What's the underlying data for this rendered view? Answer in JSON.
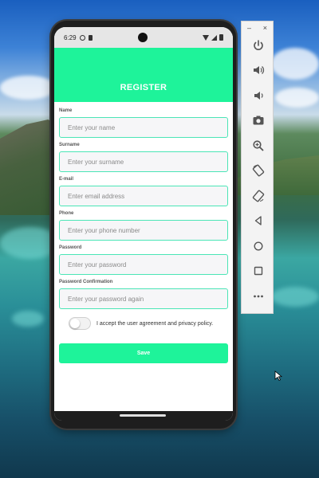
{
  "status_bar": {
    "time": "6:29"
  },
  "header": {
    "title": "REGISTER"
  },
  "form": {
    "fields": [
      {
        "label": "Name",
        "placeholder": "Enter your name"
      },
      {
        "label": "Surname",
        "placeholder": "Enter your surname"
      },
      {
        "label": "E-mail",
        "placeholder": "Enter email address"
      },
      {
        "label": "Phone",
        "placeholder": "Enter your phone number"
      },
      {
        "label": "Password",
        "placeholder": "Enter your password"
      },
      {
        "label": "Password Confirmation",
        "placeholder": "Enter your password again"
      }
    ],
    "agreement_text": "I accept the user agreement and privacy policy.",
    "agreement_checked": false,
    "save_label": "Save"
  },
  "emulator_toolbar": {
    "minimize": "–",
    "close": "×",
    "buttons": [
      "power-icon",
      "volume-up-icon",
      "volume-down-icon",
      "camera-icon",
      "zoom-icon",
      "rotate-left-icon",
      "rotate-right-icon",
      "back-icon",
      "home-icon",
      "overview-icon",
      "more-icon"
    ]
  },
  "colors": {
    "accent": "#1ef39a",
    "input_border": "#4be5b6"
  }
}
